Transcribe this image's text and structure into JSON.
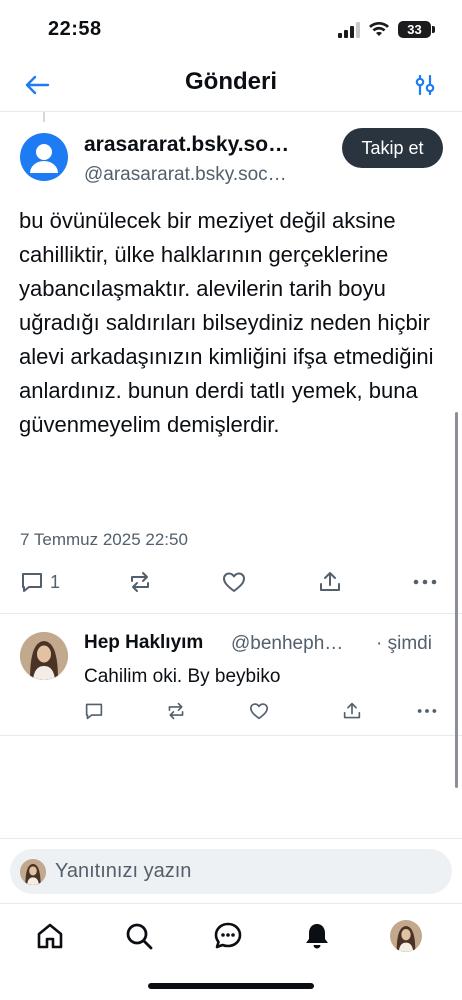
{
  "status_bar": {
    "time": "22:58",
    "battery": "33"
  },
  "header": {
    "title": "Gönderi"
  },
  "post": {
    "author_name": "arasararat.bsky.so…",
    "author_handle": "@arasararat.bsky.soc…",
    "follow_label": "Takip et",
    "text": "bu övünülecek bir meziyet değil aksine cahilliktir, ülke halklarının gerçeklerine yabancılaşmaktır. alevilerin tarih boyu uğradığı saldırıları bilseydiniz neden hiçbir alevi arkadaşınızın kimliğini ifşa etmediğini anlardınız. bunun derdi tatlı yemek, buna güvenmeyelim demişlerdir.",
    "date": "7 Temmuz 2025 22:50",
    "reply_count": "1"
  },
  "reply": {
    "author_name": "Hep Haklıyım",
    "author_handle": "@benheph…",
    "time": "· şimdi",
    "text": "Cahilim oki. By beybiko"
  },
  "composer": {
    "placeholder": "Yanıtınızı yazın"
  },
  "tabs": [
    "home-icon",
    "search-icon",
    "chat-icon",
    "notifications-icon",
    "profile-avatar"
  ]
}
